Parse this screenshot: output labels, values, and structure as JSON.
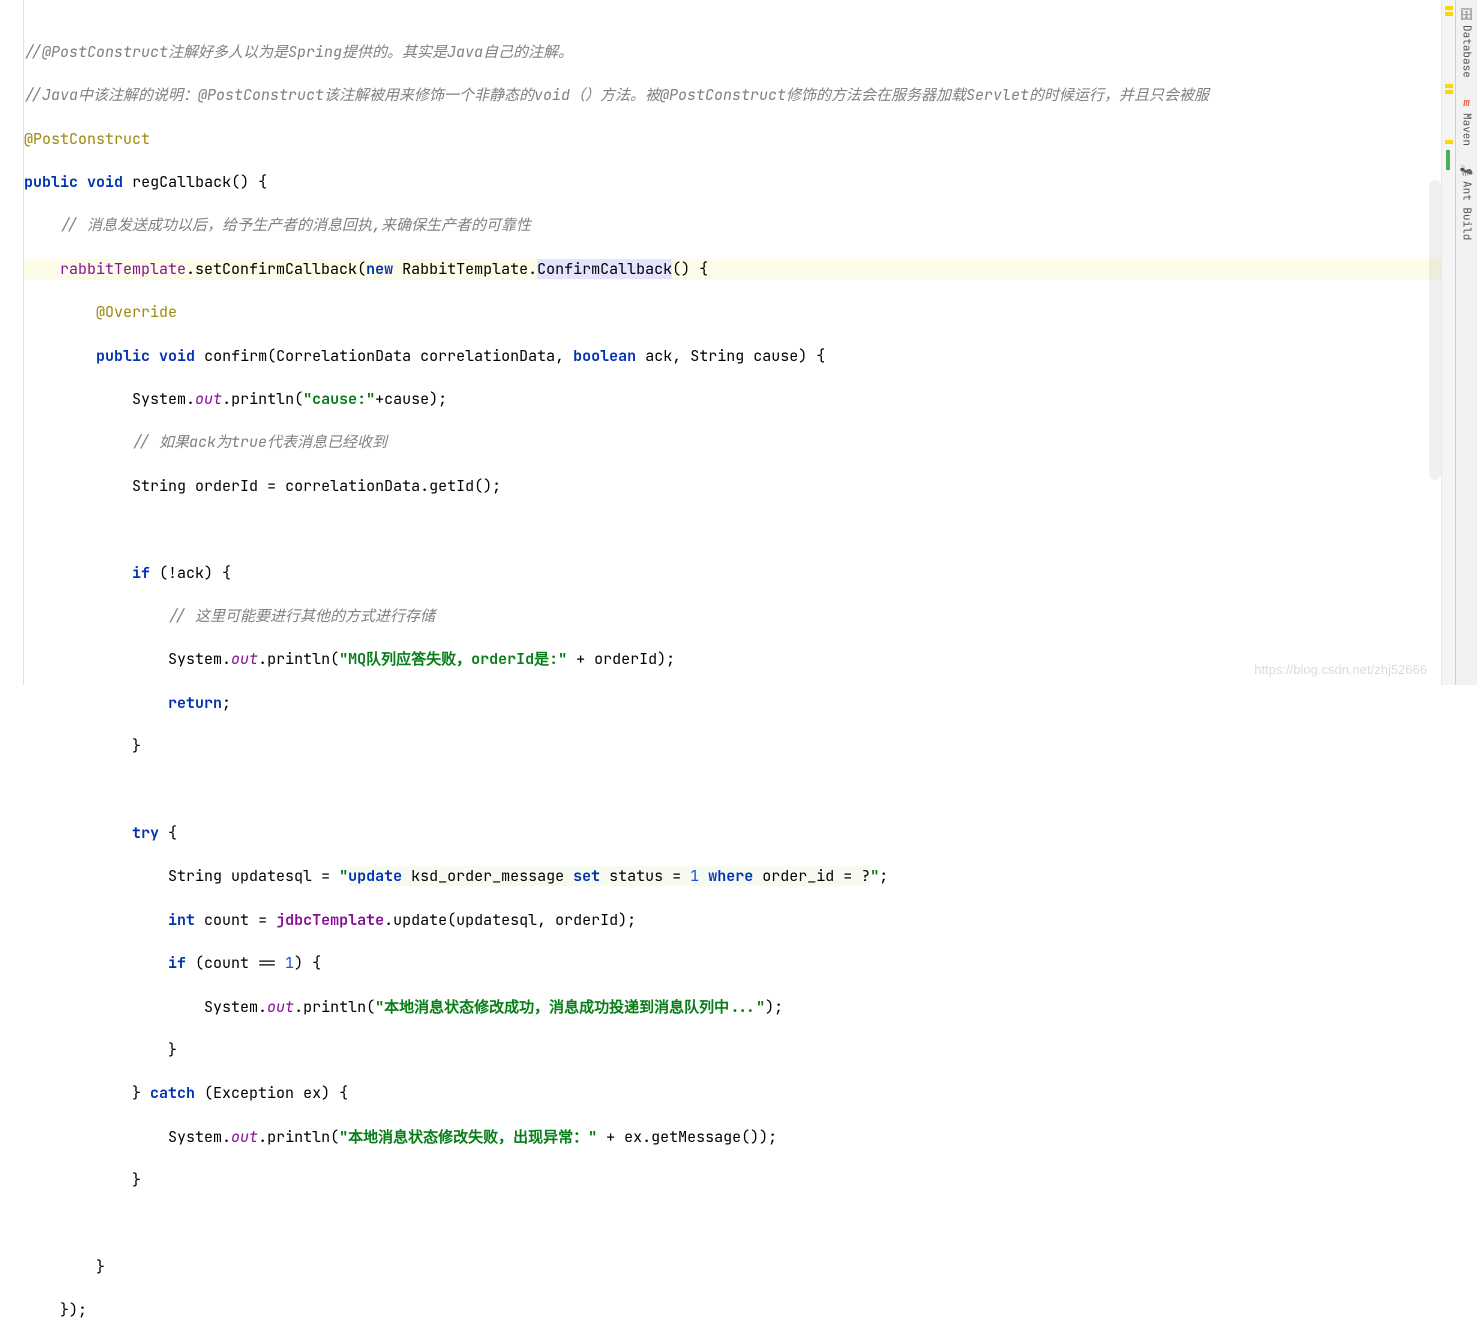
{
  "code": {
    "c1": "//@PostConstruct注解好多人以为是Spring提供的。其实是Java自己的注解。",
    "c2": "//Java中该注解的说明：@PostConstruct该注解被用来修饰一个非静态的void（）方法。被@PostConstruct修饰的方法会在服务器加载Servlet的时候运行，并且只会被服",
    "annotation": "@PostConstruct",
    "kw_public": "public",
    "kw_void": "void",
    "method_reg": "regCallback",
    "c3": "// 消息发送成功以后，给予生产者的消息回执,来确保生产者的可靠性",
    "field_rabbit": "rabbitTemplate",
    "setConfirm": "setConfirmCallback",
    "kw_new": "new",
    "type_rabbit": "RabbitTemplate",
    "type_confirm": "ConfirmCallback",
    "anno_override": "@Override",
    "method_confirm": "confirm",
    "type_corr": "CorrelationData",
    "param_corr": "correlationData",
    "kw_boolean": "boolean",
    "param_ack": "ack",
    "type_string": "String",
    "param_cause": "cause",
    "system": "System",
    "out": "out",
    "println": "println",
    "str_cause": "\"cause:\"",
    "c4": "// 如果ack为true代表消息已经收到",
    "var_orderid": "orderId",
    "getId": "getId",
    "kw_if": "if",
    "c5": "// 这里可能要进行其他的方式进行存储",
    "str_mqfail": "\"MQ队列应答失败，orderId是:\"",
    "kw_return": "return",
    "kw_try": "try",
    "var_updatesql": "updatesql",
    "sql_pre": "\"",
    "sql_update": "update",
    "sql_table": " ksd_order_message ",
    "sql_set": "set",
    "sql_status": " status = ",
    "sql_one": "1",
    "sql_where": "where",
    "sql_orderid": " order_id = ?",
    "sql_post": "\"",
    "kw_int": "int",
    "var_count": "count",
    "field_jdbc": "jdbcTemplate",
    "update": "update",
    "num_1": "1",
    "str_success": "\"本地消息状态修改成功，消息成功投递到消息队列中...\"",
    "kw_catch": "catch",
    "type_exc": "Exception",
    "param_ex": "ex",
    "str_fail": "\"本地消息状态修改失败，出现异常：\"",
    "getMessage": "getMessage"
  },
  "tools": {
    "database": "Database",
    "maven": "Maven",
    "ant": "Ant Build"
  },
  "watermark": "https://blog.csdn.net/zhj52666"
}
